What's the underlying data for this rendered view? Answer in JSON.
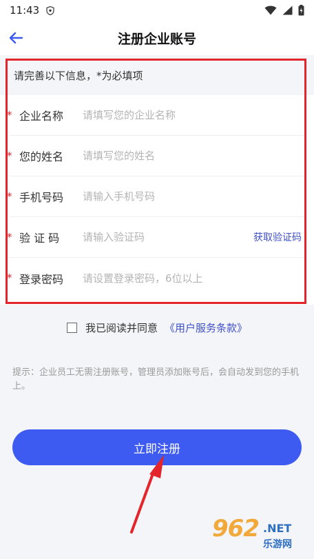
{
  "status_bar": {
    "time": "11:43"
  },
  "header": {
    "title": "注册企业账号",
    "back_icon": "arrow-left-icon"
  },
  "form": {
    "notice": "请完善以下信息，*为必填项",
    "required_mark": "*",
    "fields": [
      {
        "label": "企业名称",
        "placeholder": "请填写您的企业名称",
        "value": ""
      },
      {
        "label": "您的姓名",
        "placeholder": "请填写您的姓名",
        "value": ""
      },
      {
        "label": "手机号码",
        "placeholder": "请输入手机号码",
        "value": ""
      },
      {
        "label": "验 证 码",
        "placeholder": "请输入验证码",
        "value": ""
      },
      {
        "label": "登录密码",
        "placeholder": "请设置登录密码，6位以上",
        "value": ""
      }
    ],
    "get_code_label": "获取验证码"
  },
  "agreement": {
    "text": "我已阅读并同意",
    "link_text": "《用户服务条款》",
    "checked": false
  },
  "tip": "提示：企业员工无需注册账号，管理员添加账号后，会自动发到您的手机上。",
  "register_button": "立即注册",
  "watermark": {
    "number": "962",
    "net": ".NET",
    "cn": "乐游网"
  },
  "colors": {
    "accent": "#3d5af1",
    "link": "#3f51c9",
    "required": "#e5262e",
    "highlight": "#e3242b"
  }
}
